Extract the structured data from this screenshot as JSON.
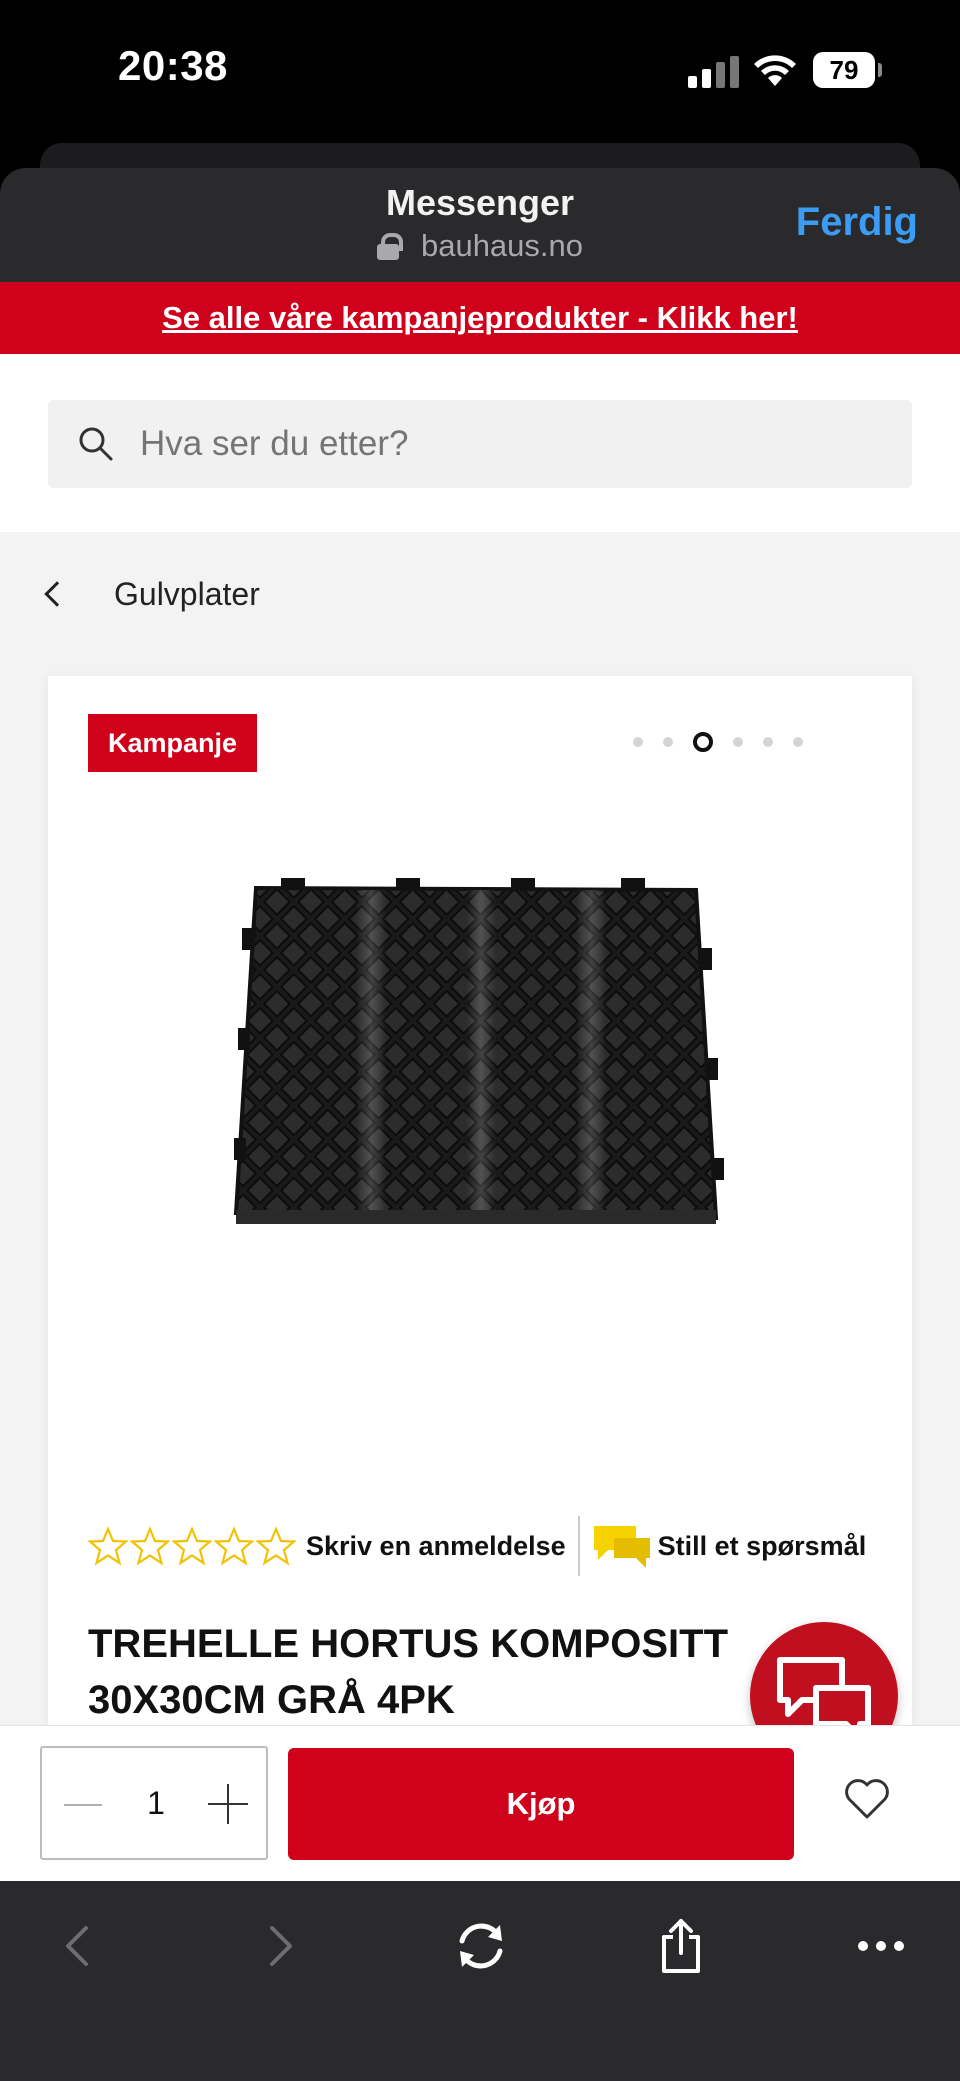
{
  "status_bar": {
    "time": "20:38",
    "battery": "79"
  },
  "sheet": {
    "title": "Messenger",
    "url": "bauhaus.no",
    "done_label": "Ferdig"
  },
  "promo_banner": "Se alle våre kampanjeprodukter - Klikk her!",
  "search": {
    "placeholder": "Hva ser du etter?"
  },
  "breadcrumb": {
    "label": "Gulvplater"
  },
  "product": {
    "badge": "Kampanje",
    "image_dots": {
      "count": 6,
      "active_index": 2
    },
    "rating": {
      "stars": 5,
      "filled": 0
    },
    "review_link": "Skriv en anmeldelse",
    "ask_link": "Still et spørsmål",
    "title": "TREHELLE HORTUS KOMPOSITT 30X30CM GRÅ 4PK"
  },
  "buy_bar": {
    "quantity": "1",
    "buy_label": "Kjøp"
  },
  "colors": {
    "brand_red": "#d0021b",
    "link_blue": "#3b9cf5",
    "chat_yellow": "#f6d200"
  },
  "icons": [
    "lock-icon",
    "search-icon",
    "chevron-left-icon",
    "star-icon",
    "chat-bubbles-icon",
    "minus-icon",
    "plus-icon",
    "heart-icon",
    "back-icon",
    "forward-icon",
    "reload-icon",
    "share-icon",
    "more-icon"
  ]
}
